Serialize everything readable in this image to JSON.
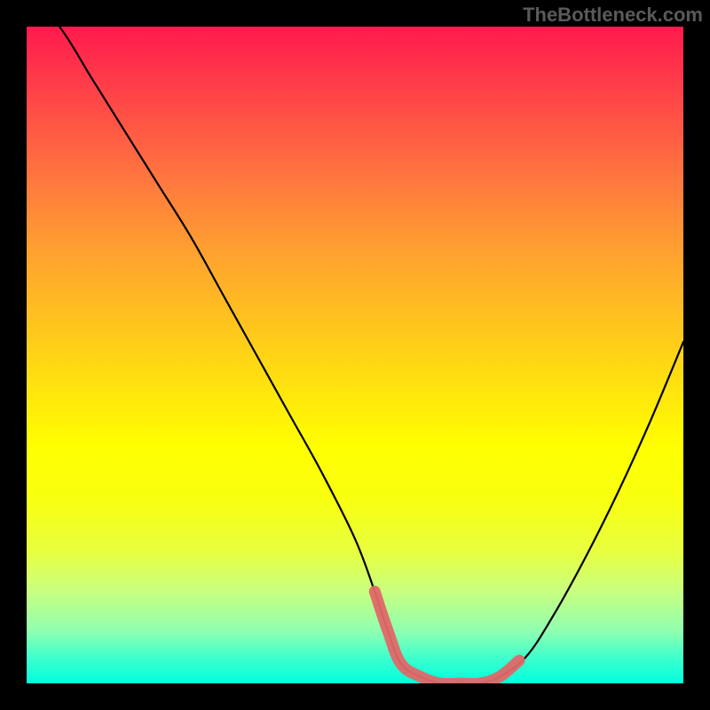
{
  "attribution": "TheBottleneck.com",
  "chart_data": {
    "type": "line",
    "title": "",
    "xlabel": "",
    "ylabel": "",
    "xlim": [
      0,
      100
    ],
    "ylim": [
      0,
      100
    ],
    "series": [
      {
        "name": "bottleneck-curve",
        "x": [
          0,
          5,
          10,
          15,
          20,
          25,
          30,
          35,
          40,
          45,
          50,
          53,
          55,
          57,
          60,
          63,
          66,
          69,
          72,
          76,
          80,
          85,
          90,
          95,
          100
        ],
        "values": [
          105,
          100,
          92,
          84,
          76,
          68,
          59,
          50,
          41,
          32,
          22,
          14,
          8,
          3,
          1,
          0,
          0,
          0,
          1,
          4,
          10,
          19,
          29,
          40,
          52
        ]
      },
      {
        "name": "highlight-segment",
        "x": [
          53,
          55,
          57,
          60,
          63,
          66,
          69,
          72,
          75
        ],
        "values": [
          14,
          8,
          3,
          1,
          0,
          0,
          0,
          1,
          3.5
        ]
      }
    ],
    "gradient_stops": [
      {
        "pos": 0,
        "color": "#ff1a4d"
      },
      {
        "pos": 50,
        "color": "#ffe010"
      },
      {
        "pos": 100,
        "color": "#00ffdd"
      }
    ]
  }
}
